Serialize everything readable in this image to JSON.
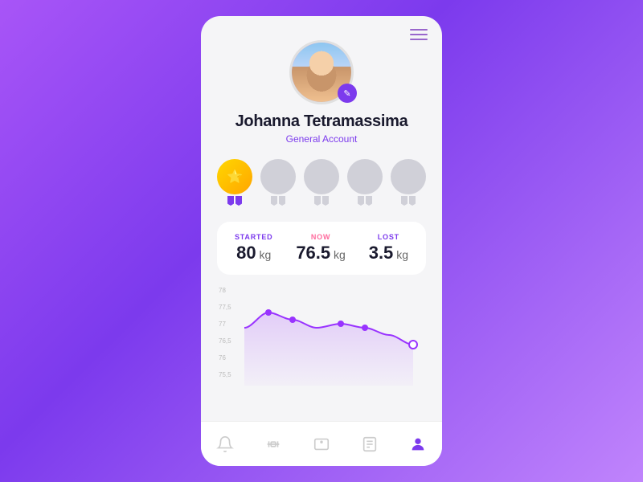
{
  "menu": {
    "label": "menu"
  },
  "user": {
    "name": "Johanna Tetramassima",
    "account_type": "General Account",
    "edit_icon": "✎"
  },
  "badges": [
    {
      "type": "gold",
      "earned": true
    },
    {
      "type": "silver",
      "earned": false
    },
    {
      "type": "silver",
      "earned": false
    },
    {
      "type": "silver",
      "earned": false
    },
    {
      "type": "silver",
      "earned": false
    }
  ],
  "stats": {
    "started": {
      "label": "STARTED",
      "value": "80",
      "unit": "kg"
    },
    "now": {
      "label": "NOW",
      "value": "76.5",
      "unit": "kg"
    },
    "lost": {
      "label": "LOST",
      "value": "3.5",
      "unit": "kg"
    }
  },
  "chart": {
    "y_labels": [
      "78",
      "77,5",
      "77",
      "76,5",
      "76",
      "75,5"
    ],
    "data_points": [
      {
        "x": 0,
        "y": 77.0
      },
      {
        "x": 1,
        "y": 77.4
      },
      {
        "x": 2,
        "y": 77.2
      },
      {
        "x": 3,
        "y": 77.0
      },
      {
        "x": 4,
        "y": 77.1
      },
      {
        "x": 5,
        "y": 77.0
      },
      {
        "x": 6,
        "y": 76.8
      },
      {
        "x": 7,
        "y": 76.5
      }
    ]
  },
  "nav": {
    "items": [
      {
        "id": "notification",
        "icon": "🔔",
        "active": false
      },
      {
        "id": "fitness",
        "icon": "⊞",
        "active": false
      },
      {
        "id": "scale",
        "icon": "⊡",
        "active": false
      },
      {
        "id": "notes",
        "icon": "☰",
        "active": false
      },
      {
        "id": "profile",
        "icon": "👤",
        "active": true
      }
    ]
  }
}
